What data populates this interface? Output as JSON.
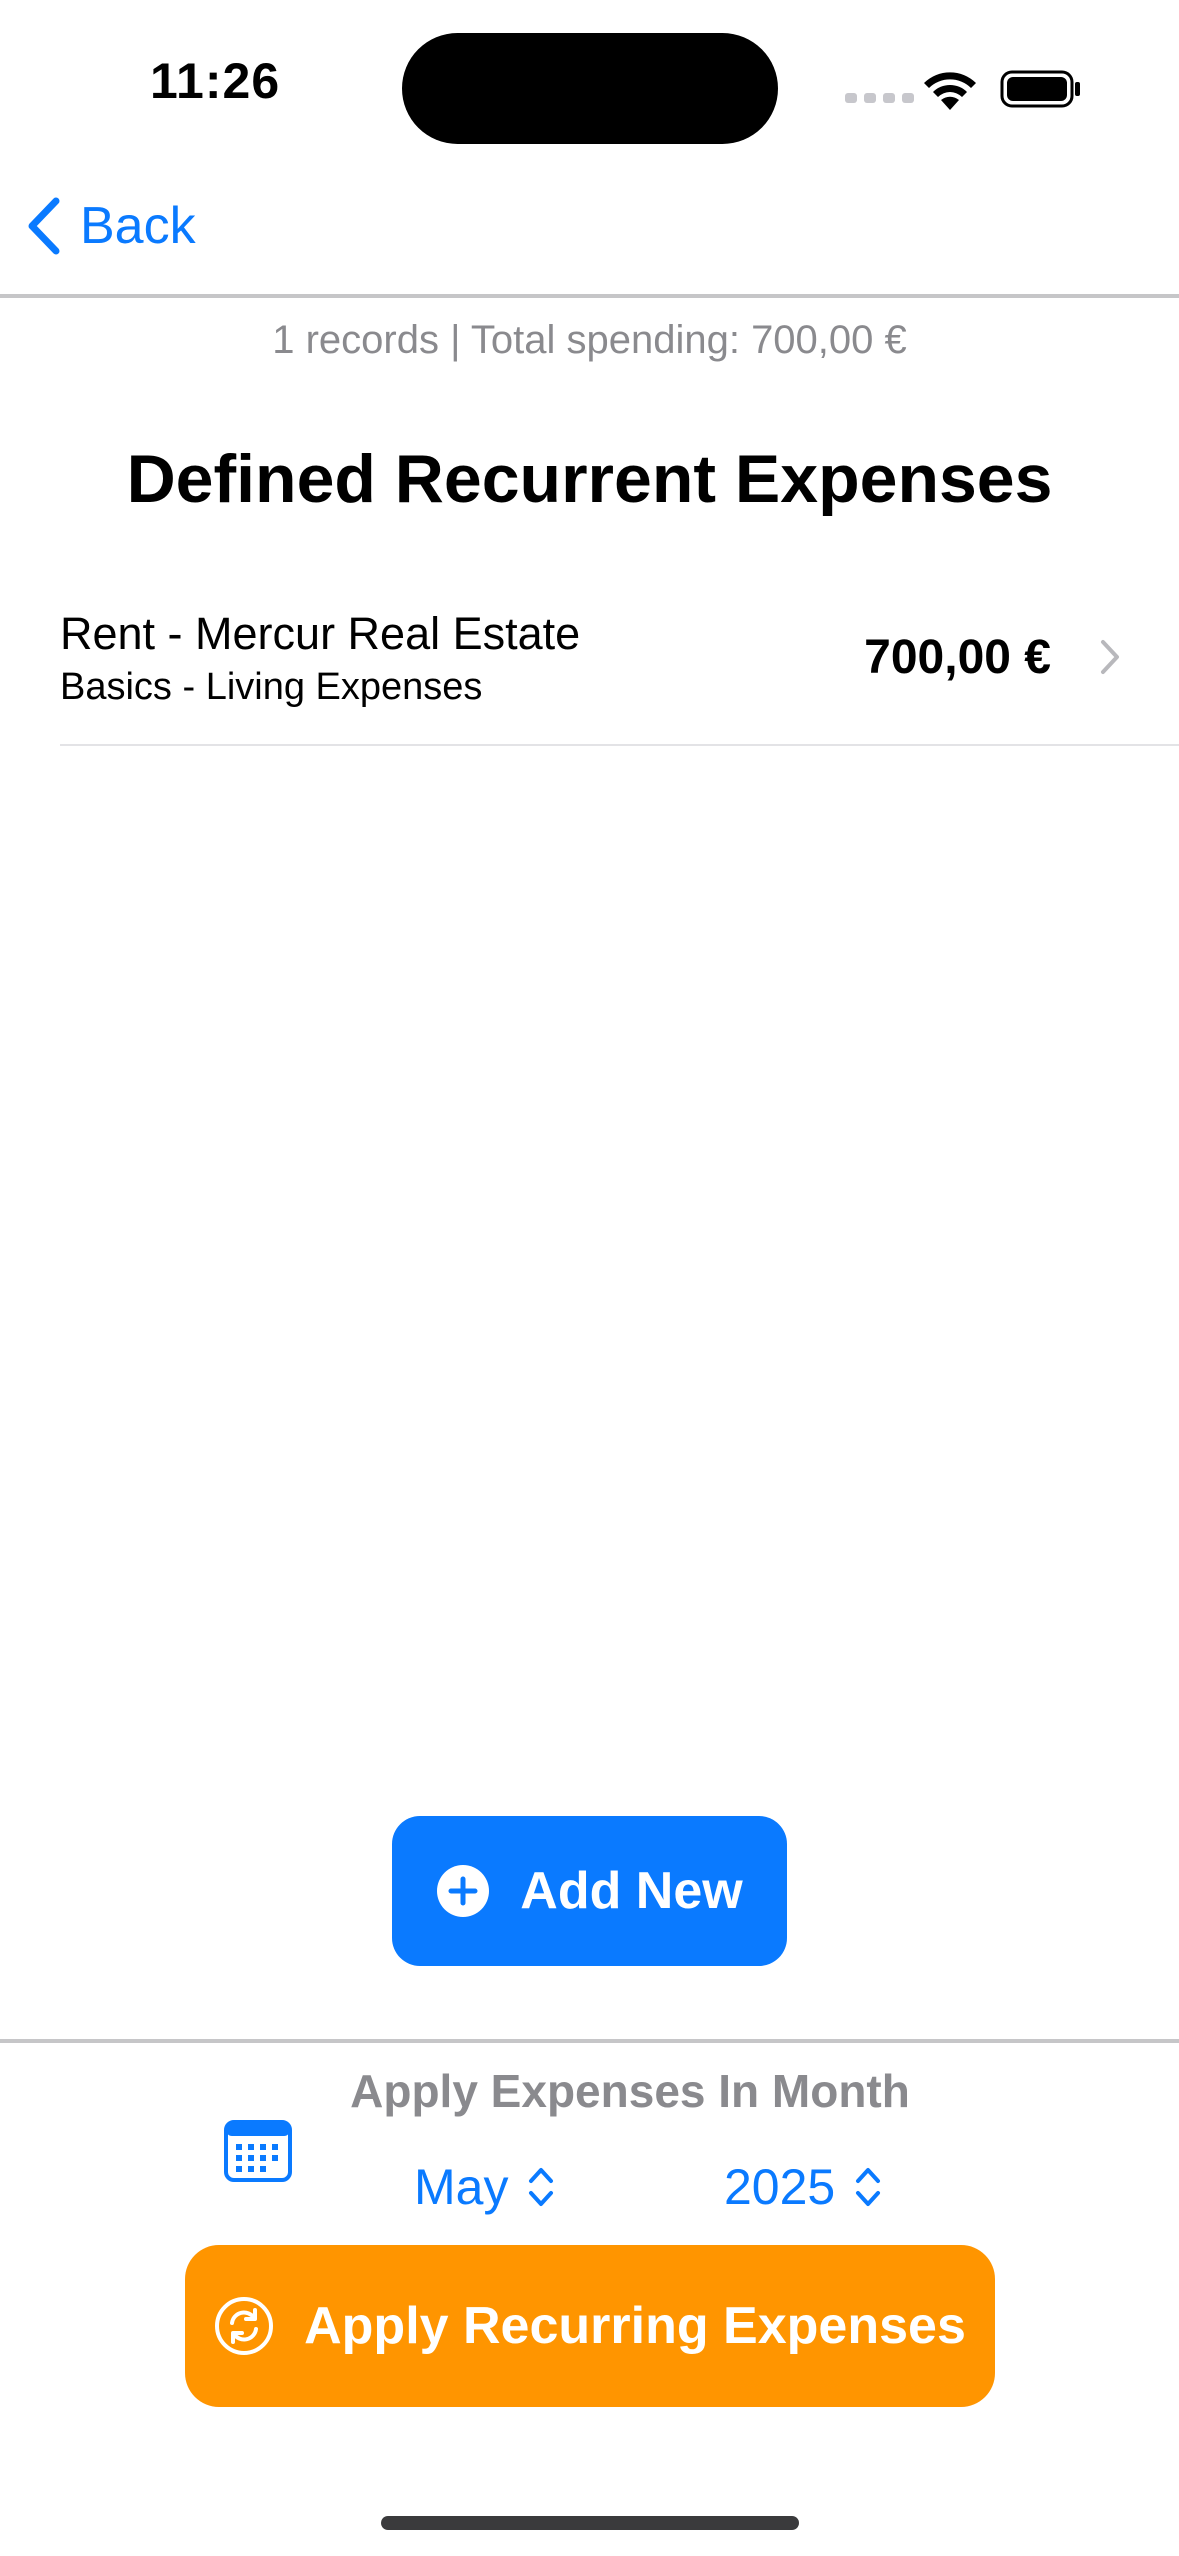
{
  "status_bar": {
    "time": "11:26"
  },
  "nav": {
    "back_label": "Back"
  },
  "summary": "1 records | Total spending: 700,00 €",
  "page_title": "Defined Recurrent Expenses",
  "expenses": [
    {
      "title": "Rent - Mercur Real Estate",
      "category": "Basics - Living Expenses",
      "amount": "700,00 €"
    }
  ],
  "add_button_label": "Add New",
  "apply_section": {
    "label": "Apply Expenses In Month",
    "month": "May",
    "year": "2025",
    "button_label": "Apply Recurring Expenses"
  },
  "colors": {
    "accent": "#0a7aff",
    "apply": "#ff9500",
    "secondary_text": "#8a8a8e"
  },
  "icons": [
    "chevron-left-icon",
    "chevron-right-icon",
    "plus-circle-icon",
    "calendar-icon",
    "chevron-up-down-icon",
    "refresh-circle-icon",
    "wifi-icon",
    "battery-icon"
  ]
}
